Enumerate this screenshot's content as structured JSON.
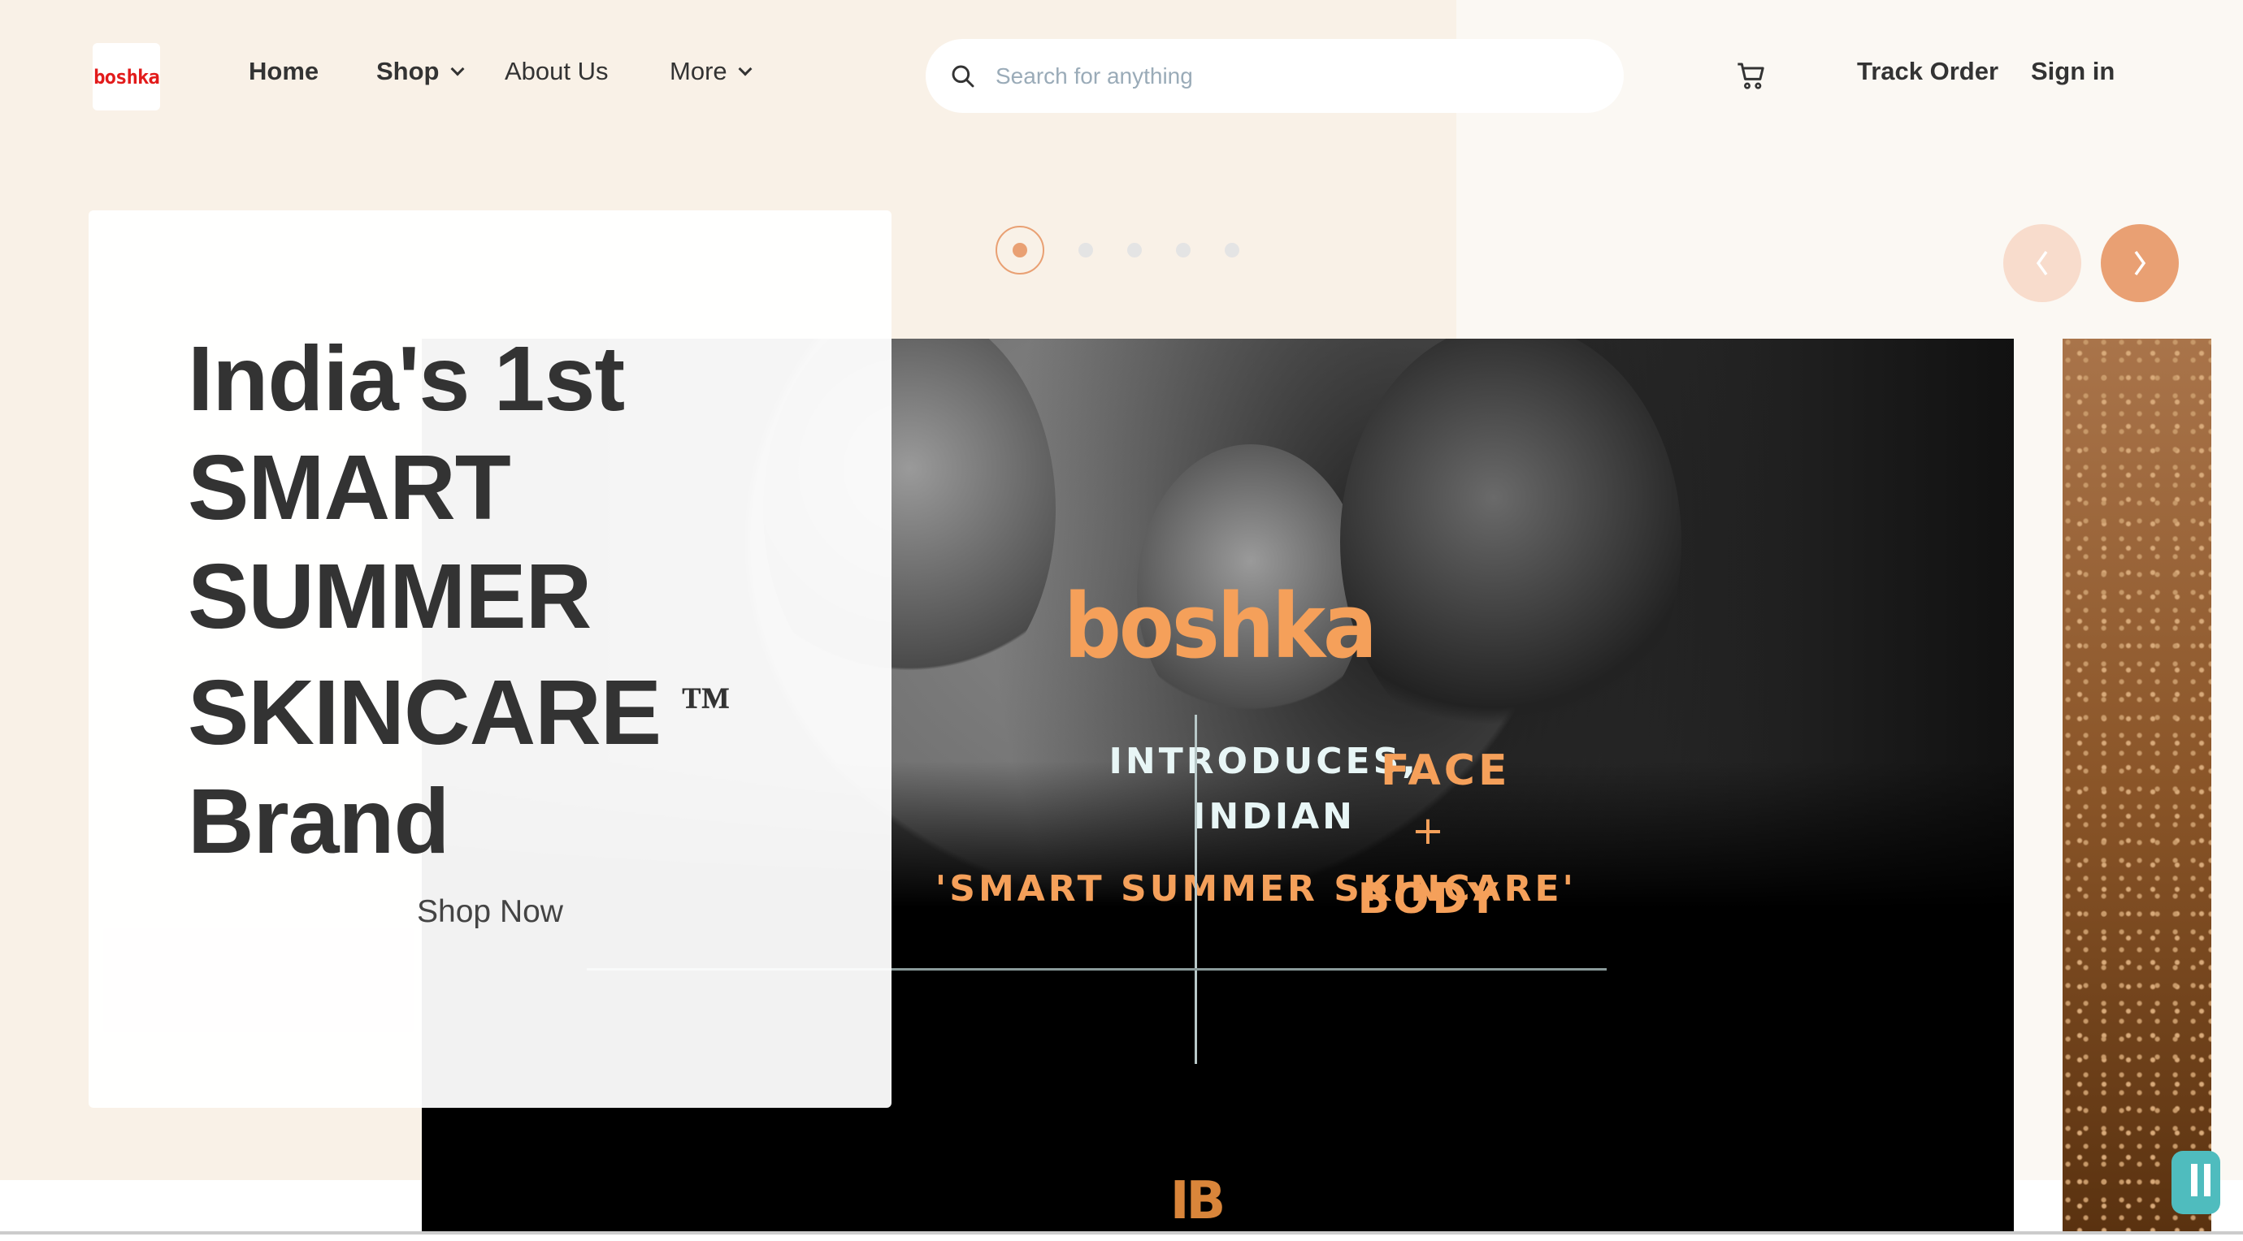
{
  "header": {
    "logo_text": "boshka",
    "nav": [
      {
        "label": "Home"
      },
      {
        "label": "Shop",
        "has_dropdown": true
      },
      {
        "label": "About Us"
      },
      {
        "label": "More",
        "has_dropdown": true
      }
    ],
    "search": {
      "placeholder": "Search for anything",
      "value": "",
      "icon": "search-icon"
    },
    "cart_icon": "cart-icon",
    "track_order": "Track Order",
    "sign_in": "Sign in"
  },
  "hero": {
    "headline_lines": [
      "India's 1st",
      "SMART",
      "SUMMER",
      "SKINCARE",
      "Brand"
    ],
    "trademark": "TM",
    "cta": "Shop Now",
    "carousel": {
      "total_slides": 5,
      "active_index": 0
    },
    "slide": {
      "brand": "boshka",
      "line1": "INTRODUCES,",
      "line2": "INDIAN",
      "line3": "'SMART SUMMER SKINCARE'",
      "face": "FACE",
      "plus": "+",
      "body": "BODY",
      "monogram": "IB"
    }
  },
  "colors": {
    "accent": "#e9a073",
    "accent_light": "#f8dccc",
    "bg": "#f9f1e7",
    "logo_red": "#e21b1b",
    "slide_orange": "#f5a05a"
  }
}
